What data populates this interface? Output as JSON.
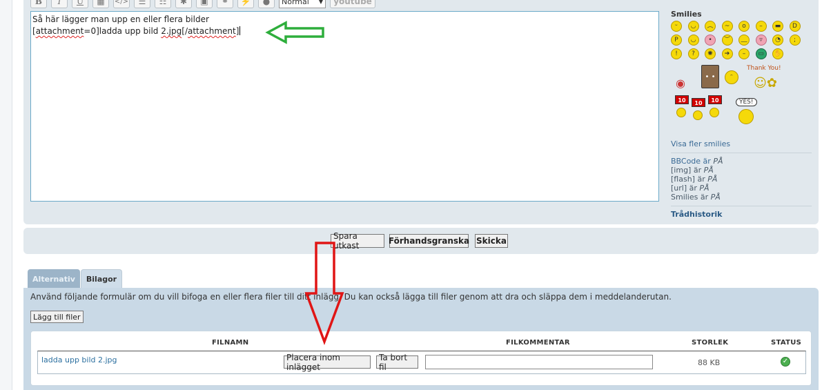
{
  "toolbar": {
    "buttons": [
      "B",
      "I",
      "U",
      "▦",
      "</>",
      "☰",
      "☷",
      "✱",
      "▣",
      "⚭",
      "⚡",
      "●"
    ],
    "font_select": "Normal",
    "media_button": "youtube"
  },
  "editor": {
    "line1": "Så här lägger man upp en eller flera bilder",
    "line2_part1": "[",
    "line2_part2": "attachment",
    "line2_part3": "=0]ladda upp bild ",
    "line2_part4": "2.jpg",
    "line2_part5": "[/",
    "line2_part6": "attachment",
    "line2_part7": "]"
  },
  "sidebar": {
    "smilies_title": "Smilies",
    "thank_you": "Thank You!",
    "sign_text": "10",
    "yes_text": "YES!",
    "more_smilies": "Visa fler smilies",
    "bbcode": "BBCode är ",
    "img": "[img] är ",
    "flash": "[flash] är ",
    "url": "[url] är ",
    "smilies": "Smilies är ",
    "on": "PÅ",
    "thread_history": "Trådhistorik"
  },
  "buttons": {
    "save_draft": "Spara utkast",
    "preview": "Förhandsgranska",
    "submit": "Skicka"
  },
  "tabs": {
    "options": "Alternativ",
    "attachments": "Bilagor"
  },
  "attachments": {
    "description": "Använd följande formulär om du vill bifoga en eller flera filer till ditt inlägg. Du kan också lägga till filer genom att dra och släppa dem i meddelanderutan.",
    "add_files": "Lägg till filer",
    "headers": {
      "filename": "FILNAMN",
      "comment": "FILKOMMENTAR",
      "size": "STORLEK",
      "status": "STATUS"
    },
    "file": {
      "name": "ladda upp bild 2.jpg",
      "place_inline": "Placera inom inlägget",
      "remove": "Ta bort fil",
      "size": "88 KB"
    }
  },
  "colors": {
    "panel": "#e1e8ed",
    "attach_panel": "#c9d9e6",
    "green_arrow": "#2eae3c",
    "red_arrow": "#e01515"
  }
}
